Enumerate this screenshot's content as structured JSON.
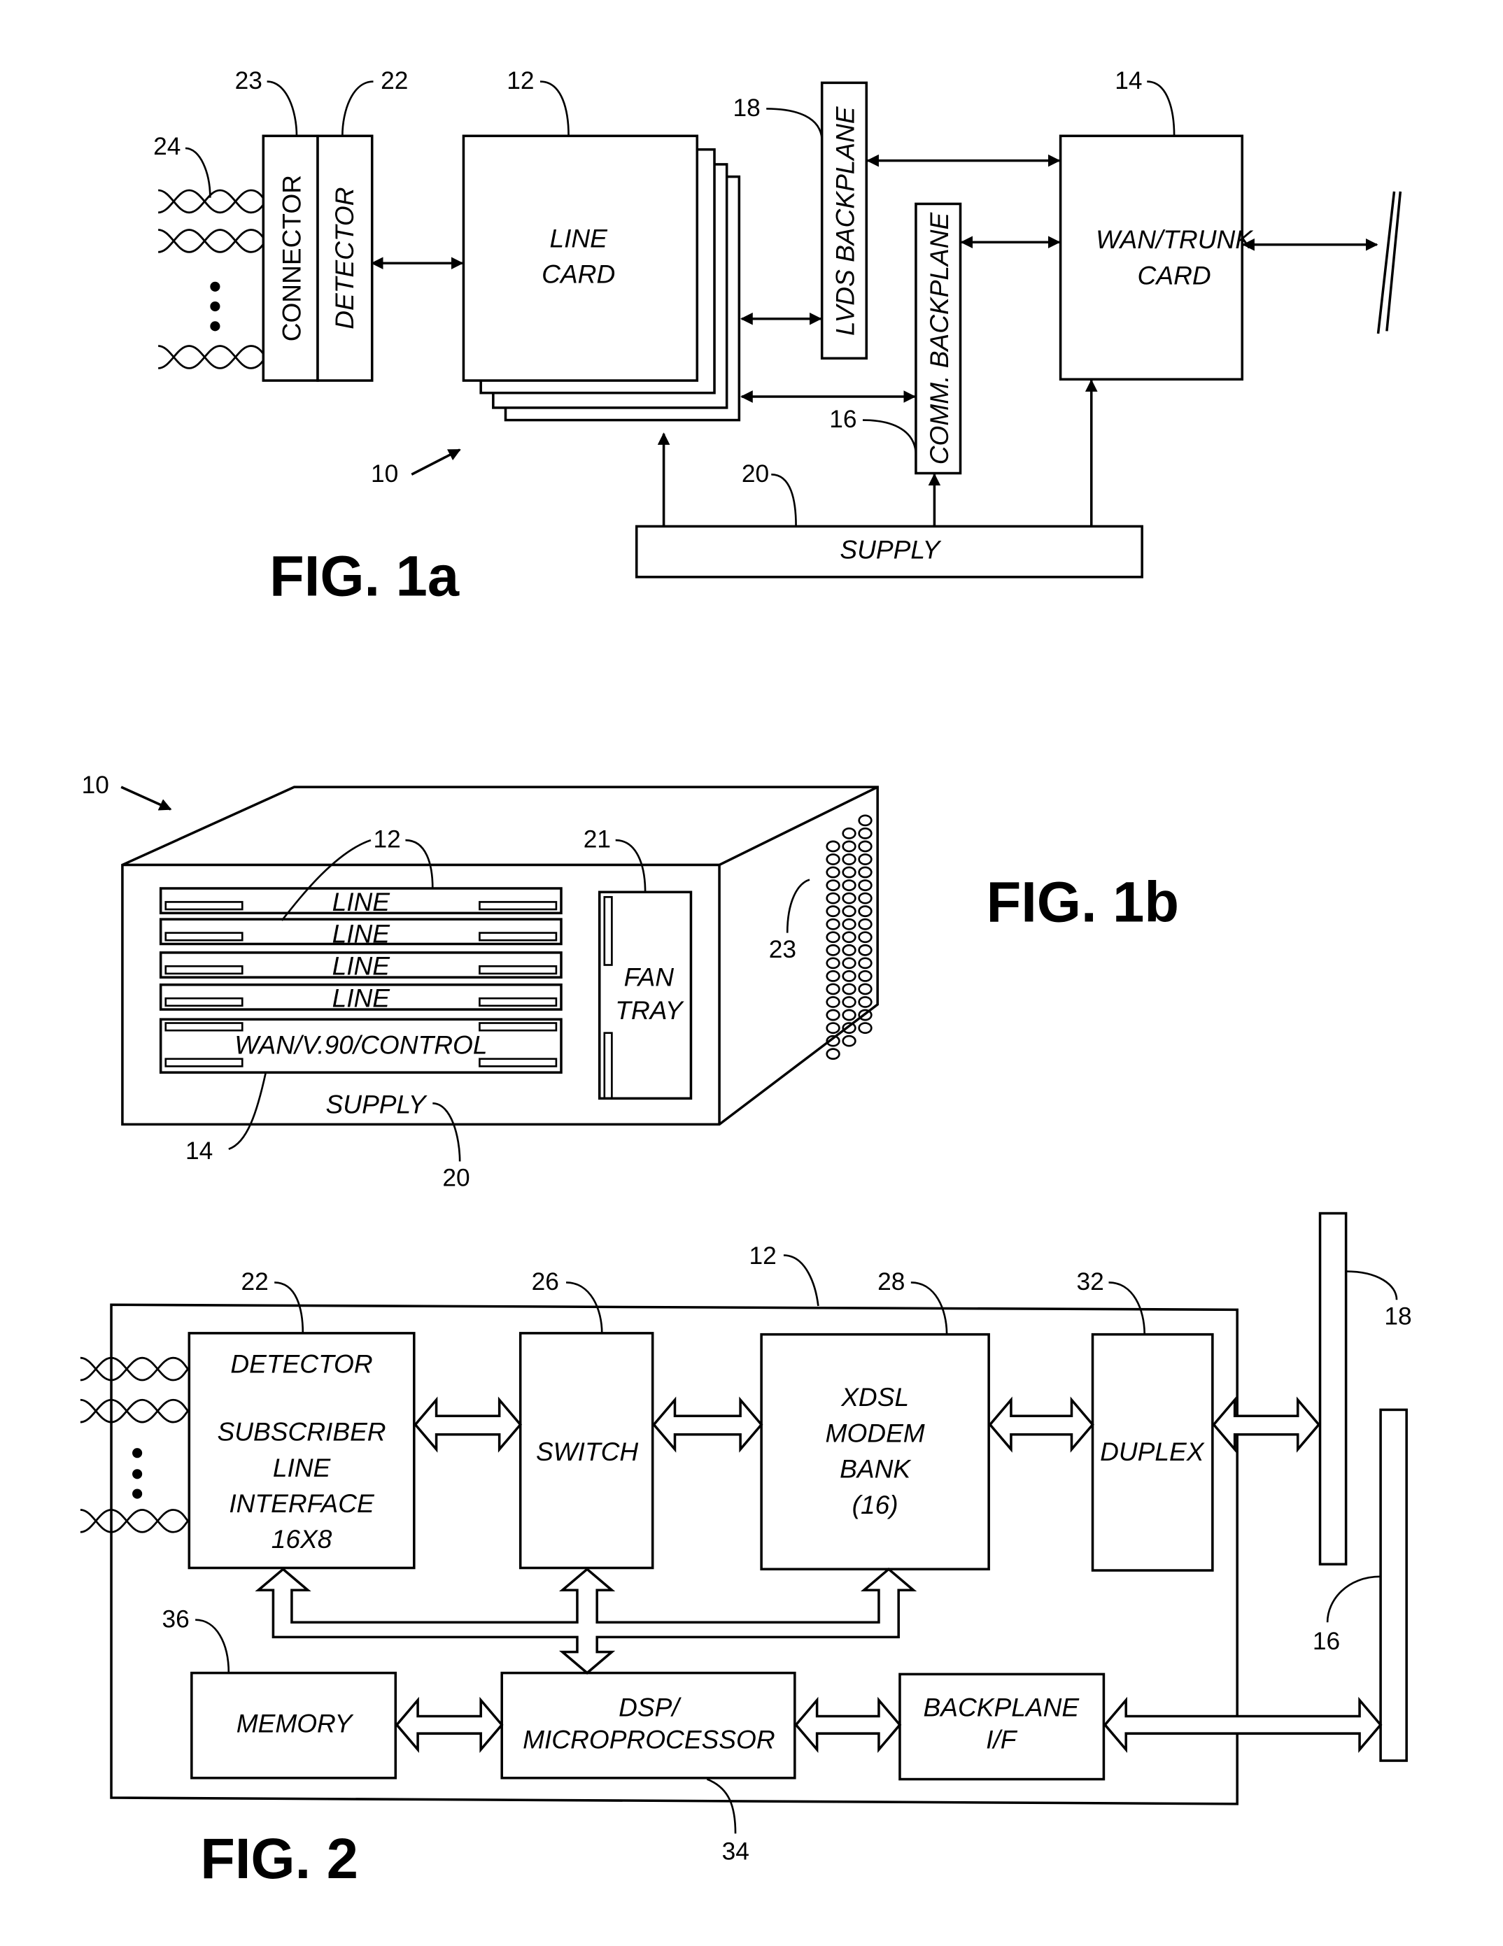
{
  "fig1a": {
    "caption": "FIG. 1a",
    "blocks": {
      "connector": "CONNECTOR",
      "detector": "DETECTOR",
      "line_card_1": "LINE",
      "line_card_2": "CARD",
      "lvds": "LVDS BACKPLANE",
      "comm": "COMM. BACKPLANE",
      "wan_1": "WAN/TRUNK",
      "wan_2": "CARD",
      "supply": "SUPPLY"
    },
    "refs": {
      "r23": "23",
      "r22": "22",
      "r24": "24",
      "r12": "12",
      "r18": "18",
      "r14": "14",
      "r16": "16",
      "r20": "20",
      "r10": "10"
    }
  },
  "fig1b": {
    "caption": "FIG. 1b",
    "slots": [
      "LINE",
      "LINE",
      "LINE",
      "LINE"
    ],
    "control": "WAN/V.90/CONTROL",
    "fan_1": "FAN",
    "fan_2": "TRAY",
    "supply": "SUPPLY",
    "refs": {
      "r10": "10",
      "r12": "12",
      "r21": "21",
      "r23": "23",
      "r14": "14",
      "r20": "20"
    }
  },
  "fig2": {
    "caption": "FIG. 2",
    "detector": [
      "DETECTOR",
      "SUBSCRIBER",
      "LINE",
      "INTERFACE",
      "16X8"
    ],
    "switch": "SWITCH",
    "modem": [
      "XDSL",
      "MODEM",
      "BANK",
      "(16)"
    ],
    "duplex": "DUPLEX",
    "memory": "MEMORY",
    "dsp": [
      "DSP/",
      "MICROPROCESSOR"
    ],
    "backplane_if": [
      "BACKPLANE",
      "I/F"
    ],
    "refs": {
      "r22": "22",
      "r26": "26",
      "r12": "12",
      "r28": "28",
      "r32": "32",
      "r18": "18",
      "r36": "36",
      "r16": "16",
      "r34": "34"
    }
  }
}
